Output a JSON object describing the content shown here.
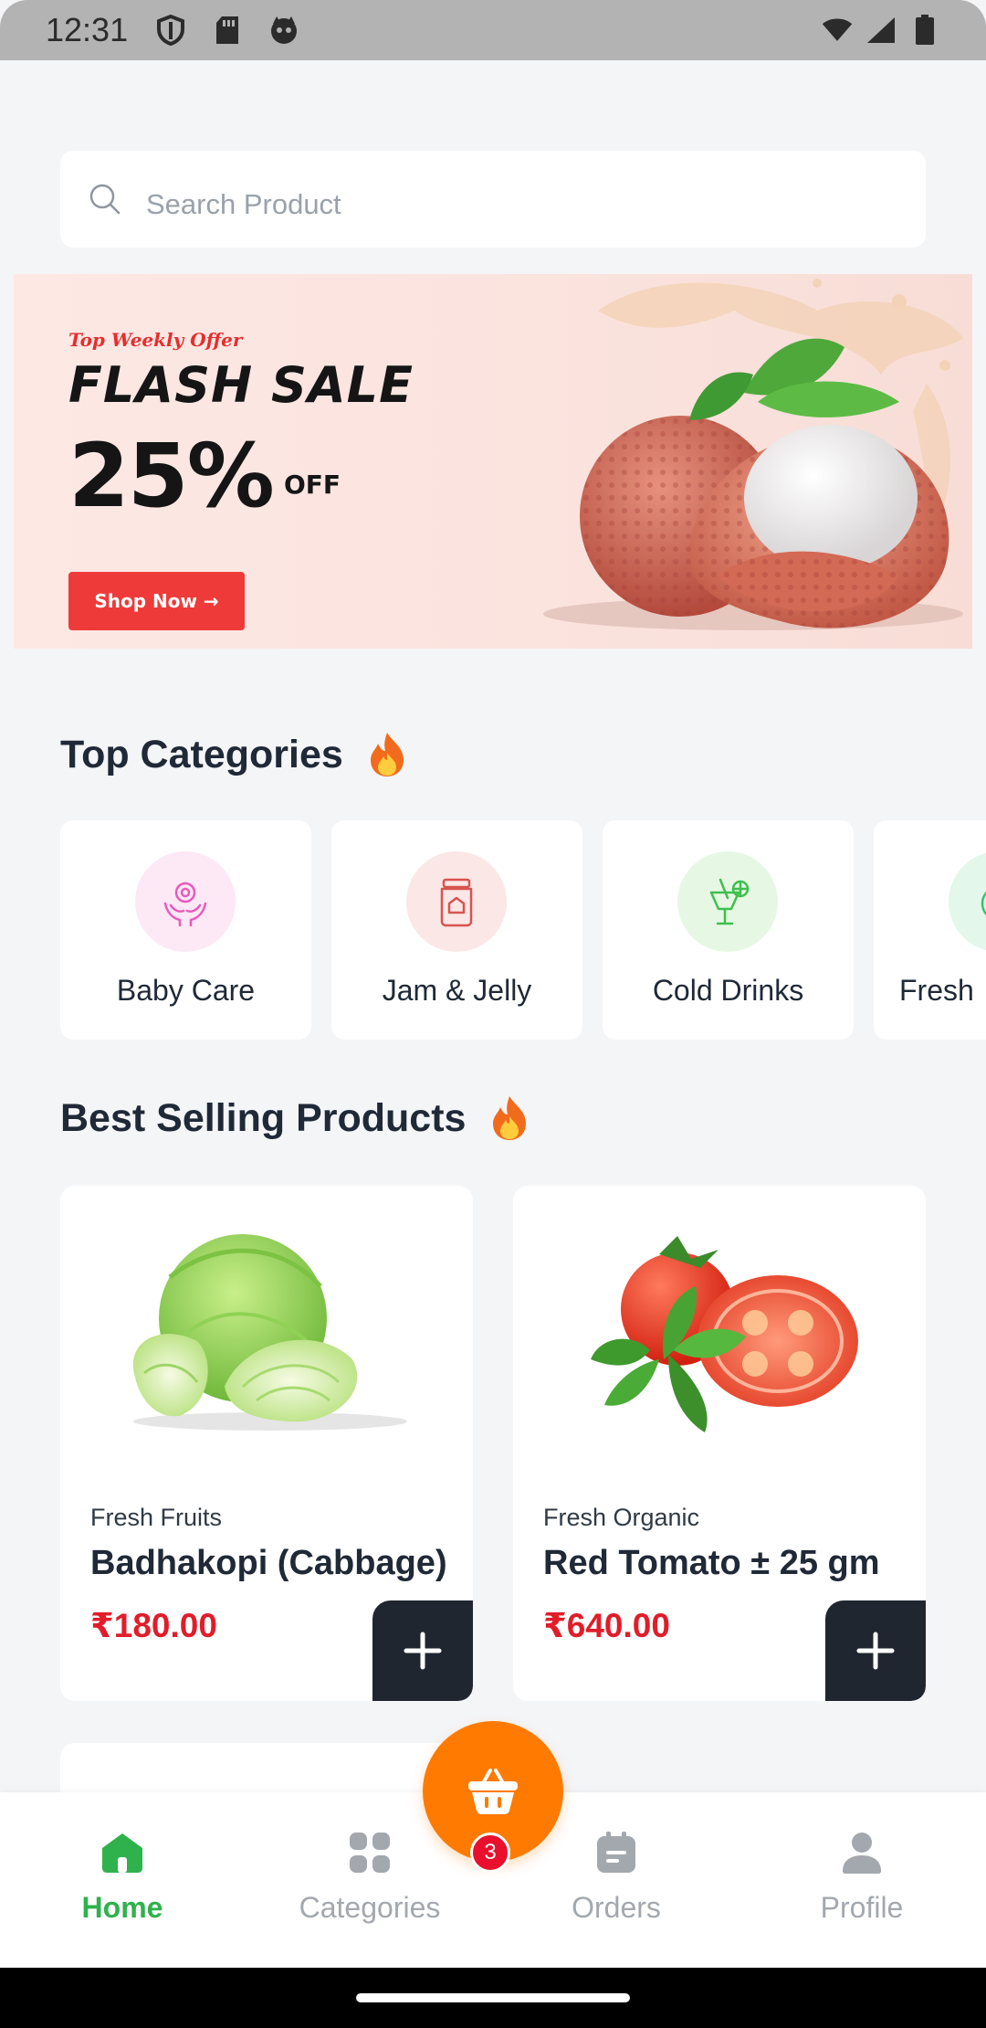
{
  "status_bar": {
    "time": "12:31",
    "left_icons": [
      "shield-icon",
      "sd-card-icon",
      "cat-face-icon"
    ],
    "right_icons": [
      "wifi-icon",
      "signal-icon",
      "battery-icon"
    ]
  },
  "search": {
    "placeholder": "Search Product"
  },
  "banner": {
    "kicker": "Top Weekly Offer",
    "title": "FLASH SALE",
    "percent": "25%",
    "off": "OFF",
    "button_label": "Shop Now →",
    "background_color": "#fde8e4",
    "button_color": "#ef3a3a"
  },
  "top_categories": {
    "title": "Top Categories",
    "items": [
      {
        "label": "Baby Care",
        "icon": "baby-hands-icon",
        "bg": "#fde8f6",
        "color": "#e75bbd"
      },
      {
        "label": "Jam & Jelly",
        "icon": "jam-jar-icon",
        "bg": "#fbe7e6",
        "color": "#d9534f"
      },
      {
        "label": "Cold Drinks",
        "icon": "cocktail-icon",
        "bg": "#e6f8e4",
        "color": "#3fbf4f"
      },
      {
        "label": "Fresh",
        "icon": "fruit-icon",
        "bg": "#e3f7ea",
        "color": "#3fbf6a"
      }
    ]
  },
  "best_selling": {
    "title": "Best Selling Products",
    "products": [
      {
        "category": "Fresh Fruits",
        "name": "Badhakopi (Cabbage)",
        "price": "₹180.00",
        "image": "cabbage-image"
      },
      {
        "category": "Fresh Organic",
        "name": "Red Tomato ± 25 gm",
        "price": "₹640.00",
        "image": "tomato-image"
      }
    ]
  },
  "bottom_nav": {
    "items": [
      {
        "label": "Home",
        "icon": "home-icon",
        "active": true
      },
      {
        "label": "Categories",
        "icon": "grid-icon",
        "active": false
      },
      {
        "label": "Orders",
        "icon": "clipboard-icon",
        "active": false
      },
      {
        "label": "Profile",
        "icon": "user-icon",
        "active": false
      }
    ],
    "cart_count": "3",
    "active_color": "#2fb24c",
    "inactive_color": "#a3a8ae",
    "fab_color": "#ff7a00"
  }
}
